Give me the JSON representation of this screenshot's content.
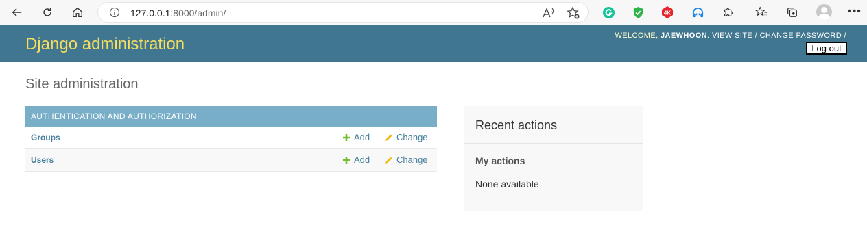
{
  "browser": {
    "url_host": "127.0.0.1",
    "url_rest": ":8000/admin/"
  },
  "header": {
    "branding": "Django administration",
    "welcome": "Welcome,",
    "username": "jaewhoon",
    "period": ".",
    "view_site": "View site",
    "slash1": "/",
    "change_password": "Change password",
    "slash2": "/",
    "logout": "Log out"
  },
  "main": {
    "title": "Site administration",
    "module": {
      "caption": "Authentication and Authorization",
      "rows": [
        {
          "name": "Groups",
          "add": "Add",
          "change": "Change"
        },
        {
          "name": "Users",
          "add": "Add",
          "change": "Change"
        }
      ]
    },
    "recent": {
      "title": "Recent actions",
      "subtitle": "My actions",
      "empty": "None available"
    }
  },
  "colors": {
    "header_bg": "#417690",
    "branding": "#f5dd5d",
    "caption_bg": "#79aec8",
    "link": "#447e9b",
    "add_icon": "#70bf2b",
    "change_icon": "#efb80b"
  },
  "icons": [
    "back-arrow-icon",
    "refresh-icon",
    "home-icon",
    "info-icon",
    "read-aloud-icon",
    "favorite-add-icon",
    "grammarly-icon",
    "shield-icon",
    "video-4k-icon",
    "headphones-icon",
    "extensions-icon",
    "favorites-icon",
    "collections-icon",
    "profile-icon",
    "more-icon",
    "add-icon",
    "change-pencil-icon"
  ]
}
